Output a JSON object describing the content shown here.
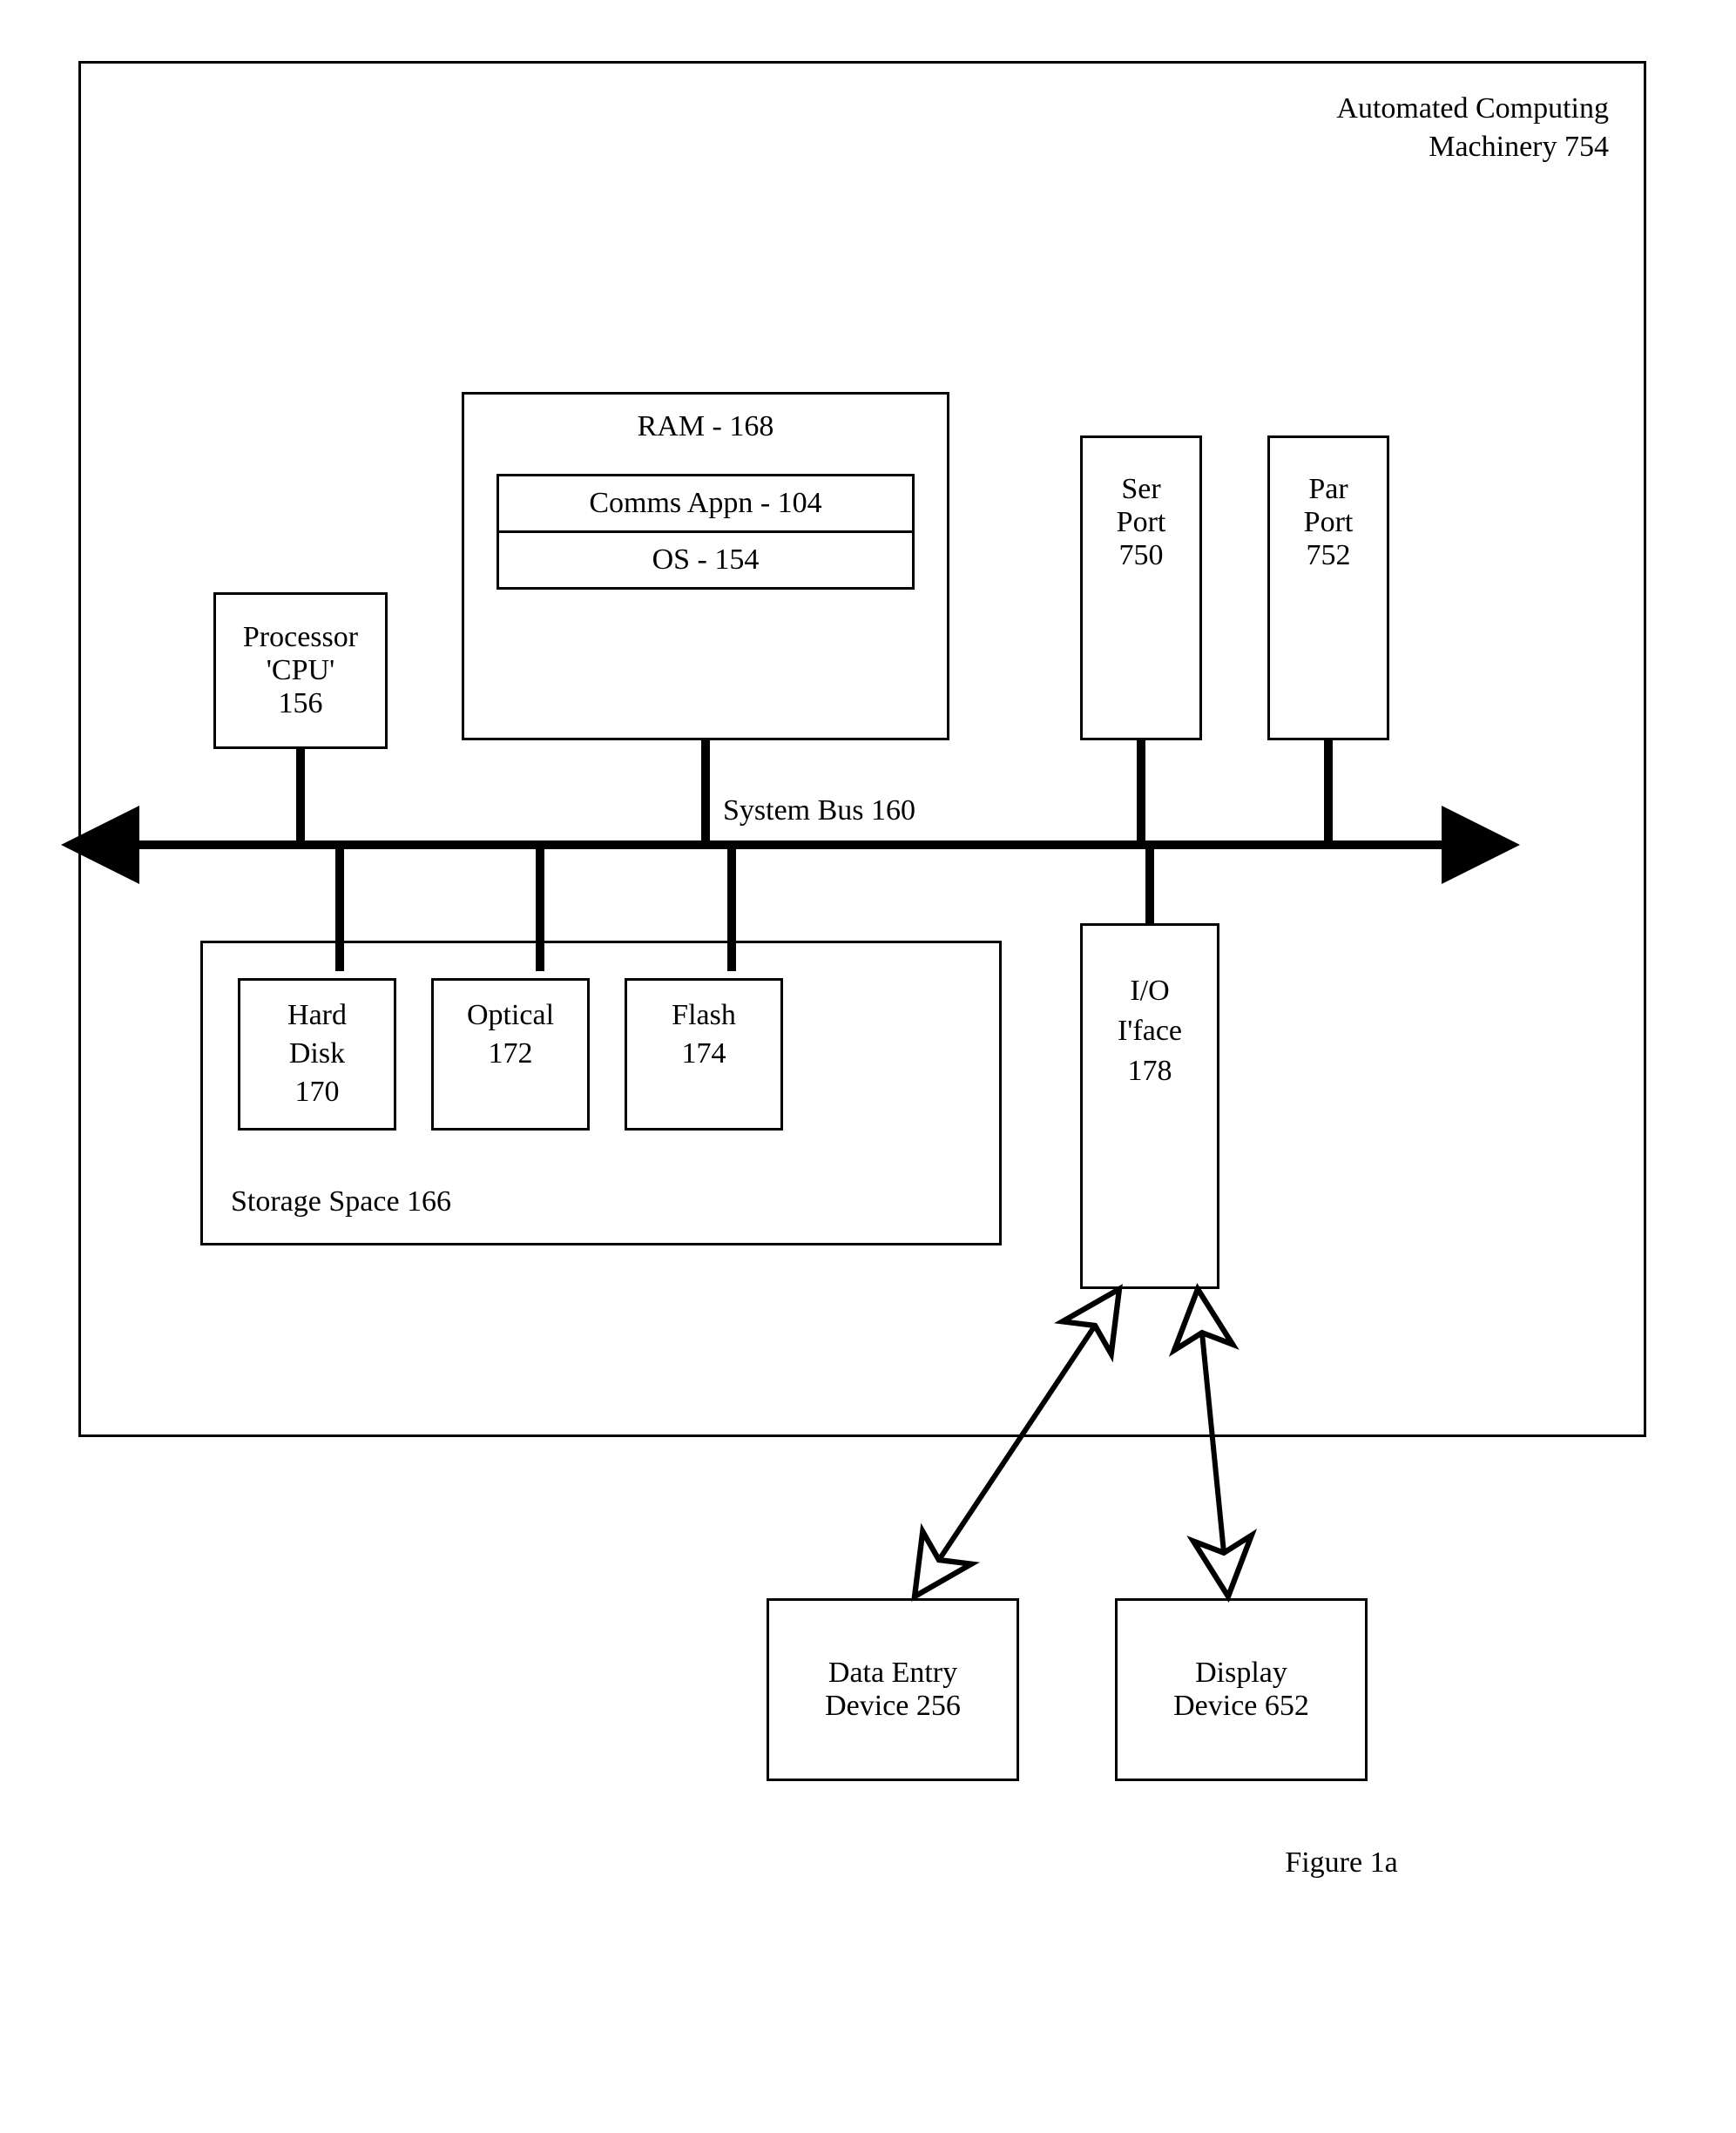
{
  "outer": {
    "title_line1": "Automated Computing",
    "title_line2": "Machinery 754"
  },
  "processor": {
    "line1": "Processor",
    "line2": "'CPU'",
    "line3": "156"
  },
  "ram": {
    "title": "RAM - 168",
    "comms": "Comms Appn - 104",
    "os": "OS - 154"
  },
  "serport": {
    "l1": "Ser",
    "l2": "Port",
    "l3": "750"
  },
  "parport": {
    "l1": "Par",
    "l2": "Port",
    "l3": "752"
  },
  "bus_label": "System Bus 160",
  "storage": {
    "label": "Storage Space 166",
    "hard": {
      "l1": "Hard",
      "l2": "Disk",
      "l3": "170"
    },
    "optical": {
      "l1": "Optical",
      "l2": "172"
    },
    "flash": {
      "l1": "Flash",
      "l2": "174"
    }
  },
  "io": {
    "l1": "I/O",
    "l2": "I'face",
    "l3": "178"
  },
  "dataentry": {
    "l1": "Data Entry",
    "l2": "Device 256"
  },
  "display": {
    "l1": "Display",
    "l2": "Device 652"
  },
  "figure": "Figure 1a"
}
